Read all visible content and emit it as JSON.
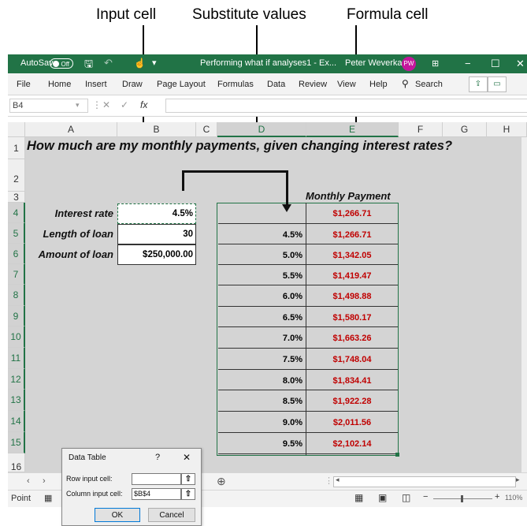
{
  "callouts": {
    "input_cell": "Input cell",
    "substitute_values": "Substitute values",
    "formula_cell": "Formula cell"
  },
  "titlebar": {
    "autosave": "AutoSave",
    "toggle": "Off",
    "filename": "Performing what if analyses1 - Ex...",
    "user": "Peter Weverka",
    "initials": "PW",
    "bg": "#217346"
  },
  "ribbon": {
    "tabs": [
      "File",
      "Home",
      "Insert",
      "Draw",
      "Page Layout",
      "Formulas",
      "Data",
      "Review",
      "View",
      "Help"
    ],
    "search": "Search"
  },
  "formula_bar": {
    "name_box": "B4",
    "fx": "fx",
    "content": ""
  },
  "sheet": {
    "columns": [
      "A",
      "B",
      "C",
      "D",
      "E",
      "F",
      "G",
      "H"
    ],
    "rows": [
      "1",
      "2",
      "3",
      "4",
      "5",
      "6",
      "7",
      "8",
      "9",
      "10",
      "11",
      "12",
      "13",
      "14",
      "15",
      "16"
    ],
    "title": "How much are my monthly payments, given changing interest rates?",
    "inputs": [
      {
        "label": "Interest rate",
        "value": "4.5%"
      },
      {
        "label": "Length of loan",
        "value": "30"
      },
      {
        "label": "Amount of loan",
        "value": "$250,000.00"
      }
    ],
    "table_header": "Monthly Payment",
    "formula_result": "$1,266.71",
    "rates": [
      "4.5%",
      "5.0%",
      "5.5%",
      "6.0%",
      "6.5%",
      "7.0%",
      "7.5%",
      "8.0%",
      "8.5%",
      "9.0%",
      "9.5%"
    ],
    "payments": [
      "$1,266.71",
      "$1,342.05",
      "$1,419.47",
      "$1,498.88",
      "$1,580.17",
      "$1,663.26",
      "$1,748.04",
      "$1,834.41",
      "$1,922.28",
      "$2,011.56",
      "$2,102.14"
    ],
    "accent": "#217346",
    "payment_color": "#c00000"
  },
  "status": {
    "mode": "Point",
    "zoom": "110%"
  },
  "dialog": {
    "title": "Data Table",
    "help": "?",
    "close": "✕",
    "row_label": "Row input cell:",
    "row_value": "",
    "col_label": "Column input cell:",
    "col_value": "$B$4",
    "ok": "OK",
    "cancel": "Cancel"
  }
}
